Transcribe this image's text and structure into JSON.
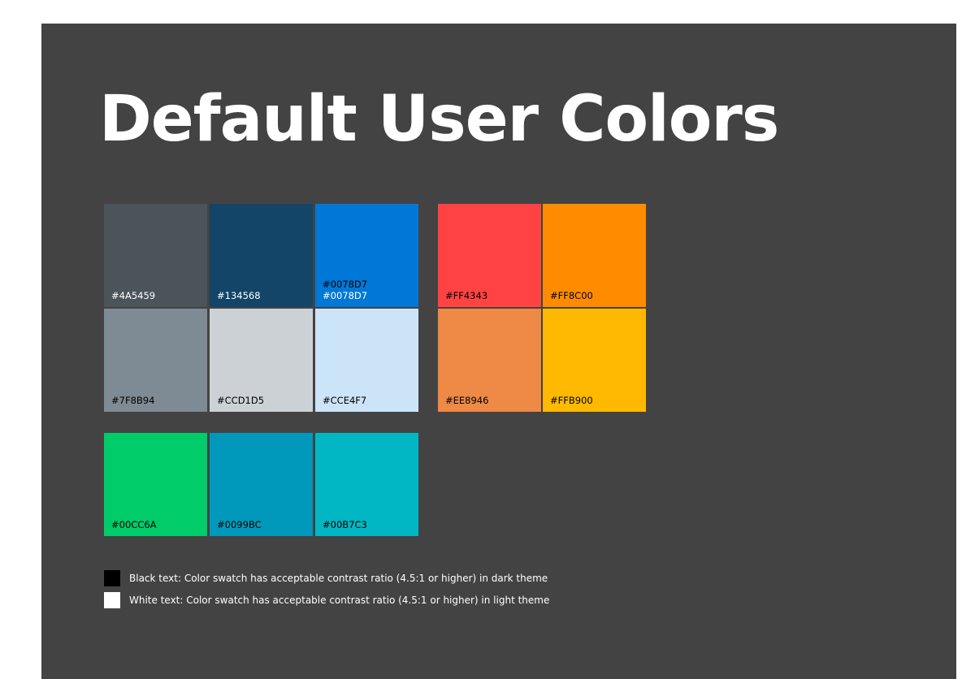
{
  "title": "Default User Colors",
  "swatches": [
    {
      "fill": "#4A5459",
      "labels": [
        "#4A5459"
      ],
      "text_color": "#ffffff"
    },
    {
      "fill": "#134568",
      "labels": [
        "#134568"
      ],
      "text_color": "#ffffff"
    },
    {
      "fill": "#0078D7",
      "labels": [
        "#0078D7",
        "#0078D7"
      ],
      "text_color_top": "#000000",
      "text_color": "#ffffff"
    },
    {
      "fill": "#7F8B94",
      "labels": [
        "#7F8B94"
      ],
      "text_color": "#000000"
    },
    {
      "fill": "#CCD1D5",
      "labels": [
        "#CCD1D5"
      ],
      "text_color": "#000000"
    },
    {
      "fill": "#CCE4F7",
      "labels": [
        "#CCE4F7"
      ],
      "text_color": "#000000"
    },
    {
      "fill": "#FF4343",
      "labels": [
        "#FF4343"
      ],
      "text_color": "#000000"
    },
    {
      "fill": "#FF8C00",
      "labels": [
        "#FF8C00"
      ],
      "text_color": "#000000"
    },
    {
      "fill": "#EE8946",
      "labels": [
        "#EE8946"
      ],
      "text_color": "#000000"
    },
    {
      "fill": "#FFB900",
      "labels": [
        "#FFB900"
      ],
      "text_color": "#000000"
    },
    {
      "fill": "#00CC6A",
      "labels": [
        "#00CC6A"
      ],
      "text_color": "#000000"
    },
    {
      "fill": "#0099BC",
      "labels": [
        "#0099BC"
      ],
      "text_color": "#000000"
    },
    {
      "fill": "#00B7C3",
      "labels": [
        "#00B7C3"
      ],
      "text_color": "#000000"
    }
  ],
  "legend": [
    {
      "color": "#000000",
      "text": "Black text: Color swatch has acceptable contrast ratio (4.5:1 or higher) in dark theme"
    },
    {
      "color": "#ffffff",
      "text": "White text: Color swatch has acceptable contrast ratio (4.5:1 or higher) in light theme"
    }
  ]
}
